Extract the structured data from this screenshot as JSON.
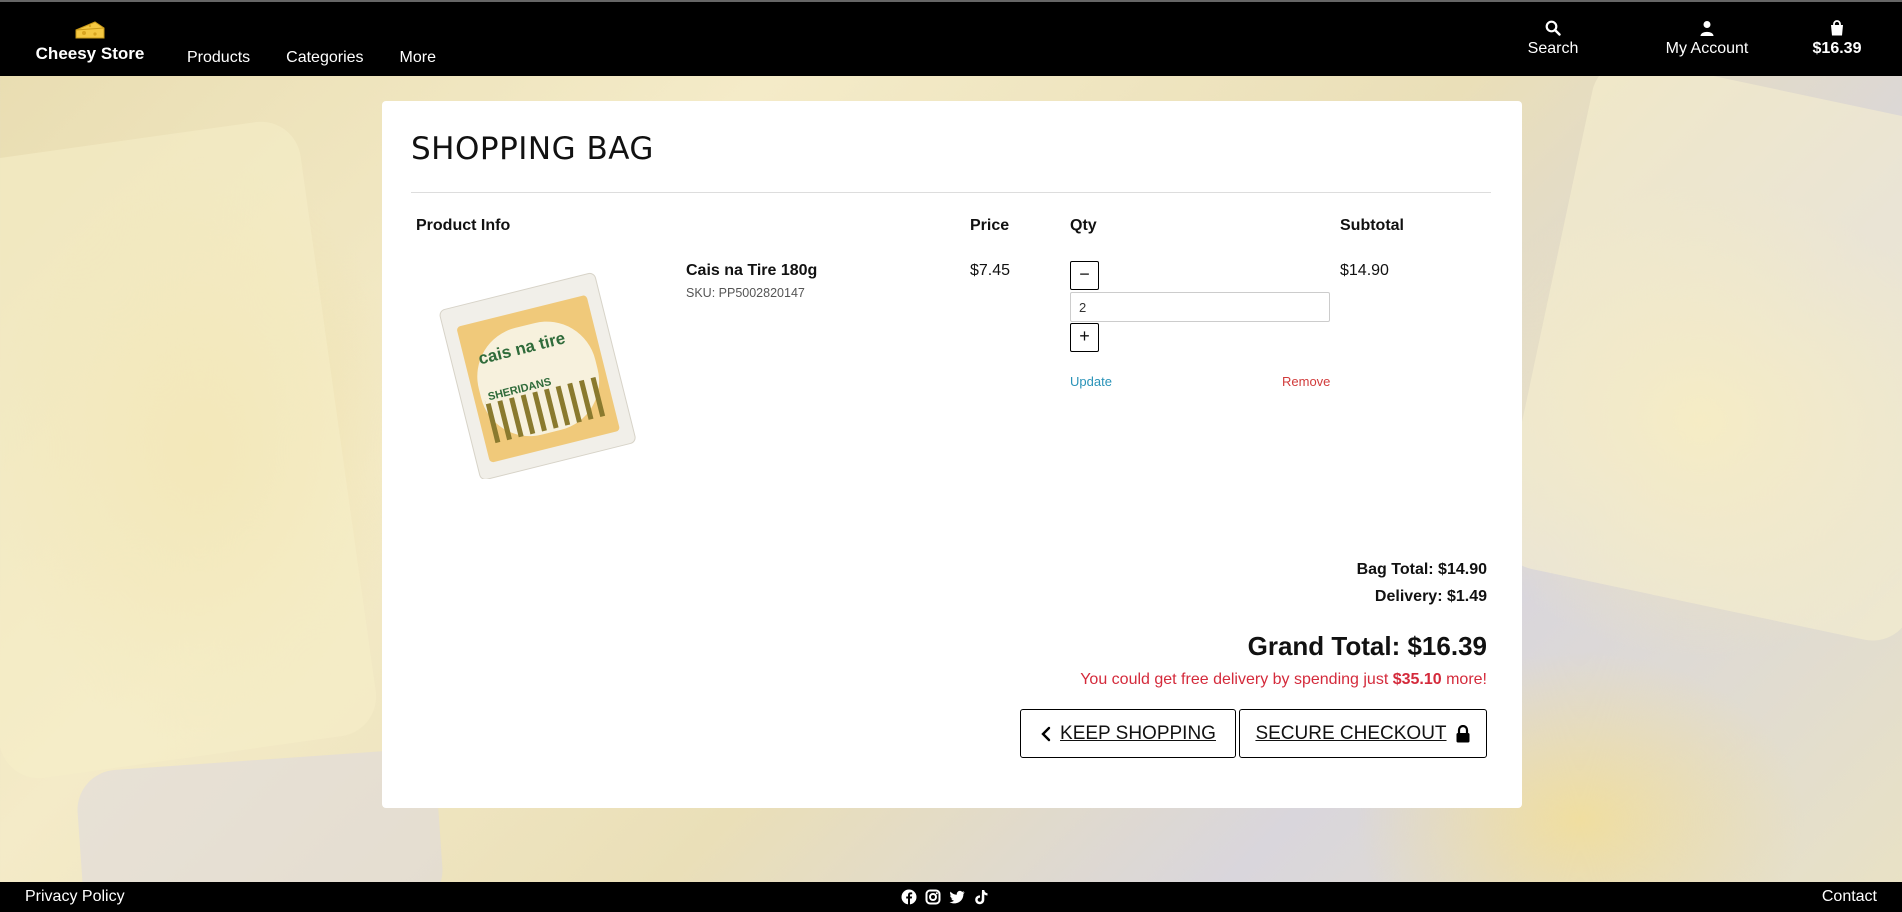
{
  "nav": {
    "brand": "Cheesy Store",
    "links": [
      "Products",
      "Categories",
      "More"
    ],
    "search_label": "Search",
    "account_label": "My Account",
    "bag_total": "$16.39"
  },
  "page": {
    "title": "SHOPPING BAG",
    "columns": {
      "info": "Product Info",
      "price": "Price",
      "qty": "Qty",
      "subtotal": "Subtotal"
    }
  },
  "item": {
    "name": "Cais na Tire 180g",
    "sku": "SKU: PP5002820147",
    "price": "$7.45",
    "qty": "2",
    "subtotal": "$14.90",
    "update_label": "Update",
    "remove_label": "Remove",
    "image_text": {
      "brand": "cais na tire",
      "maker": "SHERIDANS"
    }
  },
  "summary": {
    "bag_total": "Bag Total: $14.90",
    "delivery": "Delivery: $1.49",
    "grand_total": "Grand Total: $16.39",
    "free_msg_prefix": "You could get free delivery by spending just ",
    "free_msg_amount": "$35.10",
    "free_msg_suffix": " more!"
  },
  "buttons": {
    "keep_shopping": "KEEP SHOPPING",
    "checkout": "SECURE CHECKOUT"
  },
  "footer": {
    "privacy": "Privacy Policy",
    "contact": "Contact",
    "socials": [
      "facebook-icon",
      "instagram-icon",
      "twitter-icon",
      "tiktok-icon"
    ]
  },
  "colors": {
    "nav_bg": "#000000",
    "update_link": "#2a93b8",
    "remove_link": "#d13b3b",
    "free_msg": "#d42a3b"
  }
}
